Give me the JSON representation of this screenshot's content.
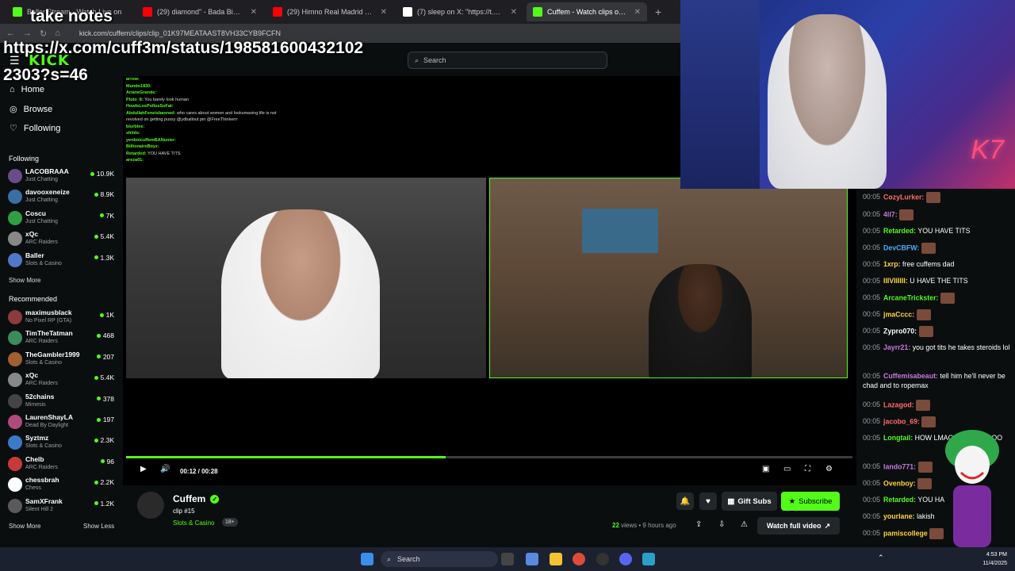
{
  "overlay": {
    "title": "take notes",
    "link_line1": "https://x.com/cuff3m/status/198581600432102",
    "link_line2": "2303?s=46"
  },
  "browser": {
    "tabs": [
      {
        "label": "Baller Stream - Watch Live on",
        "icon_color": "#53fc18"
      },
      {
        "label": "(29) diamond\" - Bada Bing Bad",
        "icon_color": "#ff0000"
      },
      {
        "label": "(29) Himno Real Madrid C.F. - Ji",
        "icon_color": "#ff0000"
      },
      {
        "label": "(7) sleep on X: \"https://t.co/K7j",
        "icon_color": "#ffffff"
      },
      {
        "label": "Cuffem - Watch clips on Kick",
        "icon_color": "#53fc18"
      }
    ],
    "url": "kick.com/cuffem/clips/clip_01K97MEATAAST8VH33CYB9FCFN"
  },
  "header": {
    "logo": "KICK",
    "search_placeholder": "Search"
  },
  "sidebar": {
    "nav": [
      {
        "label": "Home",
        "icon": "home-icon"
      },
      {
        "label": "Browse",
        "icon": "compass-icon"
      },
      {
        "label": "Following",
        "icon": "heart-icon"
      }
    ],
    "following_title": "Following",
    "following": [
      {
        "name": "LACOBRAAA",
        "category": "Just Chatting",
        "viewers": "10.9K",
        "color": "#6a4c8c"
      },
      {
        "name": "davooxeneize",
        "category": "Just Chatting",
        "viewers": "8.9K",
        "color": "#3a6ea5"
      },
      {
        "name": "Coscu",
        "category": "Just Chatting",
        "viewers": "7K",
        "color": "#2f9e44"
      },
      {
        "name": "xQc",
        "category": "ARC Raiders",
        "viewers": "5.4K",
        "color": "#888888"
      },
      {
        "name": "Baller",
        "category": "Slots & Casino",
        "viewers": "1.3K",
        "color": "#5078c8"
      }
    ],
    "show_more_1": "Show More",
    "recommended_title": "Recommended",
    "recommended": [
      {
        "name": "maximusblack",
        "category": "No Pixel RP (GTA)",
        "viewers": "1K",
        "color": "#8c3a3a"
      },
      {
        "name": "TimTheTatman",
        "category": "ARC Raiders",
        "viewers": "468",
        "color": "#3a8c5a"
      },
      {
        "name": "TheGambler1999",
        "category": "Slots & Casino",
        "viewers": "207",
        "color": "#a06030"
      },
      {
        "name": "xQc",
        "category": "ARC Raiders",
        "viewers": "5.4K",
        "color": "#888888"
      },
      {
        "name": "52chains",
        "category": "Mimesis",
        "viewers": "378",
        "color": "#444444"
      },
      {
        "name": "LaurenShayLA",
        "category": "Dead By Daylight",
        "viewers": "197",
        "color": "#b04a7a"
      },
      {
        "name": "Syztmz",
        "category": "Slots & Casino",
        "viewers": "2.3K",
        "color": "#3a7ac8"
      },
      {
        "name": "Chelb",
        "category": "ARC Raiders",
        "viewers": "96",
        "color": "#c83a3a"
      },
      {
        "name": "chessbrah",
        "category": "Chess",
        "viewers": "2.2K",
        "color": "#ffffff"
      },
      {
        "name": "SamXFrank",
        "category": "Silent Hill 2",
        "viewers": "1.2K",
        "color": "#5a5a5a"
      }
    ],
    "show_more_2": "Show More",
    "show_less": "Show Less"
  },
  "video": {
    "inner_chat": [
      {
        "user": "arrow:",
        "text": ""
      },
      {
        "user": "Mundo1830:",
        "text": ""
      },
      {
        "user": "ArianeGrande:",
        "text": ""
      },
      {
        "user": "Pluto_8:",
        "text": "You barely look human"
      },
      {
        "user": "HowIsLosPollosSoFat:",
        "text": ""
      },
      {
        "user": "AbdullahFeneisbanned:",
        "text": "who cares about women and looksmaxing life is not"
      },
      {
        "user": "",
        "text": "revolved on getting pussy @ydballout pin @FreeThinkerrr"
      },
      {
        "user": "",
        "text": ""
      },
      {
        "user": "blurbiee:",
        "text": ""
      },
      {
        "user": "shiids:",
        "text": ""
      },
      {
        "user": "yenbolcuffemBANunier:",
        "text": ""
      },
      {
        "user": "",
        "text": ""
      },
      {
        "user": "",
        "text": ""
      },
      {
        "user": "BillionaireBoyz:",
        "text": ""
      },
      {
        "user": "Retarded:",
        "text": "YOU HAVE TITS"
      },
      {
        "user": "",
        "text": ""
      },
      {
        "user": "areza01:",
        "text": ""
      }
    ],
    "time": "00:12 / 00:28",
    "progress": 0.44
  },
  "clip": {
    "streamer": "Cuffem",
    "title": "clip #15",
    "category": "Slots & Casino",
    "age_badge": "18+",
    "views_count": "22",
    "views_label": "views",
    "ago": "• 9 hours ago",
    "gift_label": "Gift Subs",
    "subscribe_label": "Subscribe",
    "watch_full_label": "Watch full video"
  },
  "chat": [
    {
      "time": "00:05",
      "user": "CozyLurker:",
      "color": "#ff6b6b",
      "text": ""
    },
    {
      "time": "00:05",
      "user": "4ll7:",
      "color": "#c678dd",
      "text": ""
    },
    {
      "time": "00:05",
      "user": "Retarded:",
      "color": "#53fc18",
      "text": "YOU HAVE TITS"
    },
    {
      "time": "00:05",
      "user": "DevCBFW:",
      "color": "#4dabf7",
      "text": ""
    },
    {
      "time": "00:05",
      "user": "1xrp:",
      "color": "#ffd43b",
      "text": "free cuffems dad"
    },
    {
      "time": "00:05",
      "user": "IIIVIIIIII:",
      "color": "#ffd43b",
      "text": "U HAVE THE TITS"
    },
    {
      "time": "00:05",
      "user": "ArcaneTrickster:",
      "color": "#53fc18",
      "text": ""
    },
    {
      "time": "00:05",
      "user": "jmaCccc:",
      "color": "#ffd43b",
      "text": ""
    },
    {
      "time": "00:05",
      "user": "Zypro070:",
      "color": "#ffffff",
      "text": ""
    },
    {
      "time": "00:05",
      "user": "Jayrr21:",
      "color": "#c678dd",
      "text": "you got tits he takes steroids lol"
    },
    {
      "time": "00:05",
      "user": "Cuffemisabeaut:",
      "color": "#c678dd",
      "text": "tell him he'll never be chad and to ropemax"
    },
    {
      "time": "00:05",
      "user": "Lazagod:",
      "color": "#ff6b6b",
      "text": ""
    },
    {
      "time": "00:05",
      "user": "jacobo_69:",
      "color": "#ff6b6b",
      "text": ""
    },
    {
      "time": "00:05",
      "user": "Longtail:",
      "color": "#53fc18",
      "text": "HOW LMAOOOOOOOOOO"
    },
    {
      "time": "00:05",
      "user": "lando771:",
      "color": "#c678dd",
      "text": ""
    },
    {
      "time": "00:05",
      "user": "Ovenboy:",
      "color": "#ffd43b",
      "text": ""
    },
    {
      "time": "00:05",
      "user": "Retarded:",
      "color": "#53fc18",
      "text": "YOU HA"
    },
    {
      "time": "00:05",
      "user": "yourlane:",
      "color": "#ffd43b",
      "text": "lakish"
    },
    {
      "time": "00:05",
      "user": "pamiscollege",
      "color": "#ffd43b",
      "text": ""
    }
  ],
  "taskbar": {
    "search_label": "Search",
    "time": "4:53 PM",
    "date": "11/4/2025"
  }
}
